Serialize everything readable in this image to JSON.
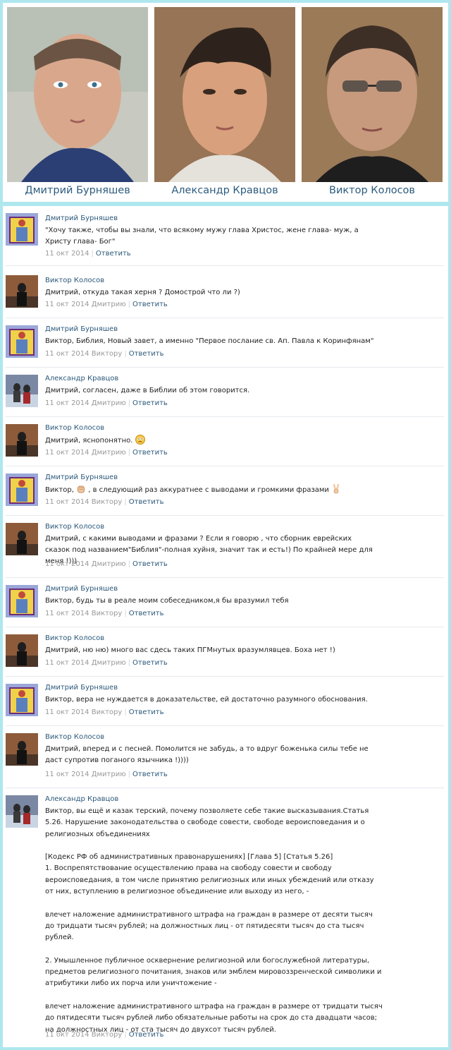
{
  "header": {
    "people": [
      {
        "name": "Дмитрий Бурняшев"
      },
      {
        "name": "Александр Кравцов"
      },
      {
        "name": "Виктор Колосов"
      }
    ]
  },
  "reply_label": "Ответить",
  "comments": [
    {
      "author": "Дмитрий Бурняшев",
      "text": "\"Хочу также, чтобы вы знали, что всякому мужу глава Христос, жене глава- муж, а Христу глава- Бог\"",
      "date": "11 окт 2014",
      "to": ""
    },
    {
      "author": "Виктор Колосов",
      "text": "Дмитрий, откуда такая херня ? Домострой что ли ?)",
      "date": "11 окт 2014",
      "to": "Дмитрию"
    },
    {
      "author": "Дмитрий Бурняшев",
      "text": "Виктор, Библия, Новый завет, а именно \"Первое послание св. Ап. Павла к Коринфянам\"",
      "date": "11 окт 2014",
      "to": "Виктору"
    },
    {
      "author": "Александр Кравцов",
      "text": "Дмитрий, согласен, даже в Библии об этом говорится.",
      "date": "11 окт 2014",
      "to": "Дмитрию"
    },
    {
      "author": "Виктор Колосов",
      "text_a": "Дмитрий, яснопонятно. ",
      "date": "11 окт 2014",
      "to": "Дмитрию"
    },
    {
      "author": "Дмитрий Бурняшев",
      "text_a": "Виктор, ",
      "text_b": " , в следующий раз аккуратнее с выводами и громкими фразами ",
      "date": "11 окт 2014",
      "to": "Виктору"
    },
    {
      "author": "Виктор Колосов",
      "text": "Дмитрий, с какими выводами и фразами ? Если я говорю , что сборник еврейских сказок под названием\"Библия\"-полная хуйня, значит так и есть!) По крайней мере для меня !)))",
      "date": "11 окт 2014",
      "to": "Дмитрию"
    },
    {
      "author": "Дмитрий Бурняшев",
      "text": "Виктор, будь ты в реале моим собеседником,я бы вразумил тебя",
      "date": "11 окт 2014",
      "to": "Виктору"
    },
    {
      "author": "Виктор Колосов",
      "text": "Дмитрий, ню ню) много вас сдесь таких ПГМнутых вразумлявцев. Боха нет !)",
      "date": "11 окт 2014",
      "to": "Дмитрию"
    },
    {
      "author": "Дмитрий Бурняшев",
      "text": "Виктор, вера не нуждается в доказательстве, ей достаточно разумного обоснования.",
      "date": "11 окт 2014",
      "to": "Виктору"
    },
    {
      "author": "Виктор Колосов",
      "text": "Дмитрий, вперед и с песней. Помолится не забудь, а то вдруг боженька силы тебе не даст супротив поганого язычника !))))",
      "date": "11 окт 2014",
      "to": "Дмитрию"
    },
    {
      "author": "Александр Кравцов",
      "text": "Виктор, вы ещё и казак терский, почему позволяете себе такие высказывания.Статья 5.26. Нарушение законодательства о свободе совести, свободе вероисповедания и о религиозных объединениях\n\n[Кодекс РФ об административных правонарушениях] [Глава 5] [Статья 5.26]\n1. Воспрепятствование осуществлению права на свободу совести и свободу вероисповедания, в том числе принятию религиозных или иных убеждений или отказу от них, вступлению в религиозное объединение или выходу из него, -\n\nвлечет наложение административного штрафа на граждан в размере от десяти тысяч до тридцати тысяч рублей; на должностных лиц - от пятидесяти тысяч до ста тысяч рублей.\n\n2. Умышленное публичное осквернение религиозной или богослужебной литературы, предметов религиозного почитания, знаков или эмблем мировоззренческой символики и атрибутики либо их порча или уничтожение -\n\nвлечет наложение административного штрафа на граждан в размере от тридцати тысяч до пятидесяти тысяч рублей либо обязательные работы на срок до ста двадцати часов; на должностных лиц - от ста тысяч до двухсот тысяч рублей.",
      "date": "11 окт 2014",
      "to": "Виктору"
    }
  ]
}
